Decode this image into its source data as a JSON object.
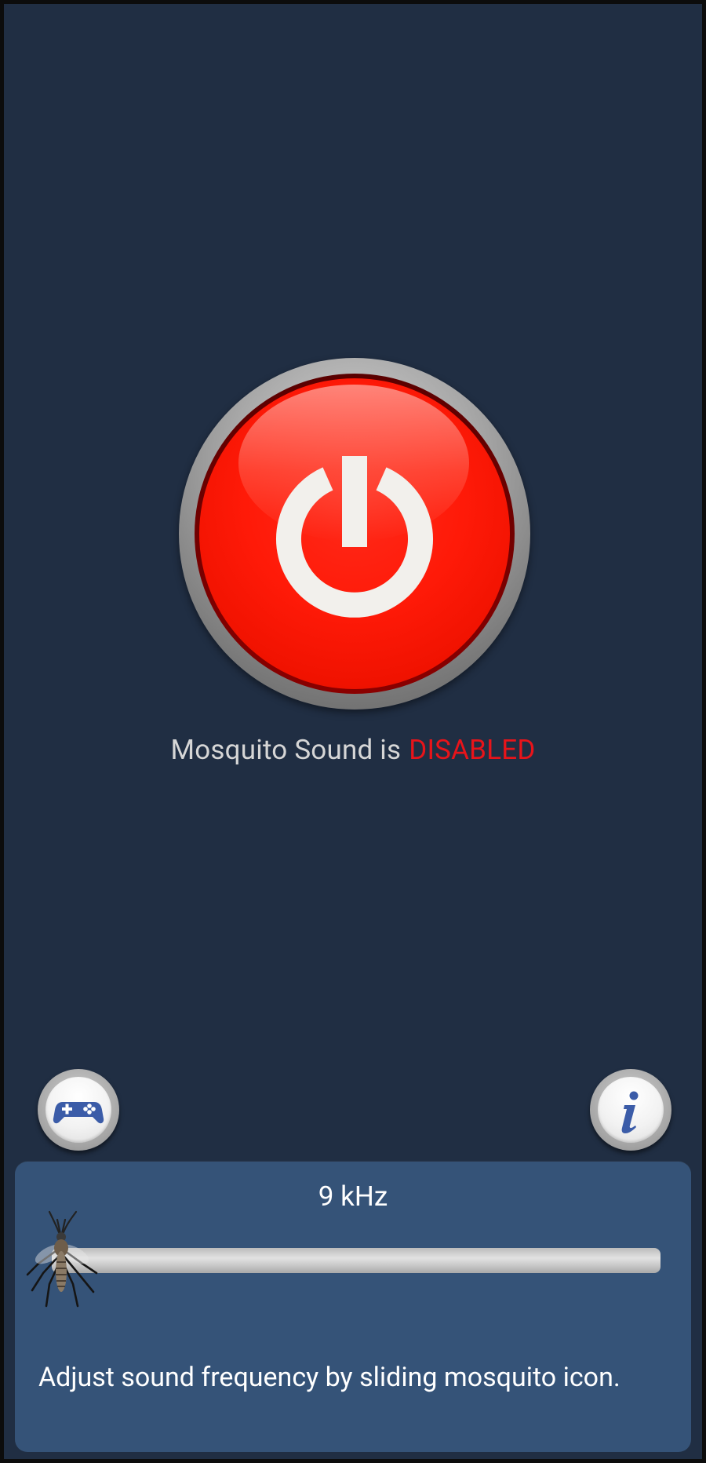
{
  "status": {
    "prefix": "Mosquito Sound is",
    "value": "DISABLED",
    "value_color": "#e8141a"
  },
  "power_button": {
    "state": "off",
    "icon": "power-icon",
    "color": "#ff1a08"
  },
  "buttons": {
    "games_icon": "gamepad-icon",
    "info_icon": "info-icon"
  },
  "frequency": {
    "label": "9 kHz",
    "value_khz": 9,
    "slider_position": 0.0,
    "thumb_icon": "mosquito-icon"
  },
  "hint": {
    "text": "Adjust sound frequency by sliding mosquito icon."
  }
}
